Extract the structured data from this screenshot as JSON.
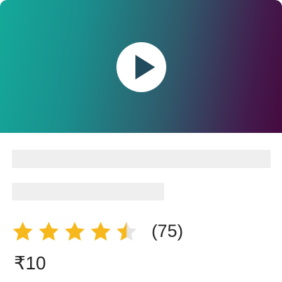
{
  "card": {
    "thumbnail": {
      "gradient_start": "#14a99a",
      "gradient_end": "#460a40",
      "play_icon": "play-icon",
      "play_button_color": "#ffffff",
      "play_triangle_color": "#214a5c"
    },
    "title_placeholder_color": "#efefef",
    "rating": {
      "value": 4.5,
      "max": 5,
      "star_color": "#f6b81c",
      "empty_star_color": "#e4e4e4",
      "count": "(75)"
    },
    "price": "₹10"
  }
}
